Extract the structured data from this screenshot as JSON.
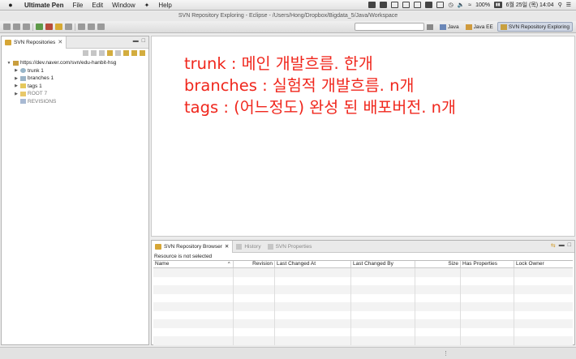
{
  "menubar": {
    "app_name": "Ultimate Pen",
    "items": [
      "File",
      "Edit",
      "Window",
      "Help"
    ],
    "battery": "100%",
    "datetime": "6월 25일 (목)  14:04"
  },
  "window": {
    "title": "SVN Repository Exploring - Eclipse - /Users/Hong/Dropbox/Bigdata_5/Java/Workspace"
  },
  "perspectives": [
    {
      "label": "Java",
      "active": false
    },
    {
      "label": "Java EE",
      "active": false
    },
    {
      "label": "SVN Repository Exploring",
      "active": true
    }
  ],
  "svn_repositories": {
    "tab_label": "SVN Repositories",
    "tree": {
      "root": "https://dev.naver.com/svn/edu-hanbit-hsg",
      "children": [
        "trunk 1",
        "branches 1",
        "tags 1",
        "ROOT 7",
        "REVISIONS"
      ]
    }
  },
  "annotation": {
    "lines": [
      "trunk : 메인 개발흐름. 한개",
      "branches : 실험적 개발흐름. n개",
      "tags : (어느정도) 완성 된 배포버전. n개"
    ],
    "color": "#f0271d"
  },
  "bottom_panel": {
    "tabs": [
      {
        "label": "SVN Repository Browser",
        "active": true
      },
      {
        "label": "History",
        "active": false
      },
      {
        "label": "SVN Properties",
        "active": false
      }
    ],
    "status": "Resource is not selected",
    "columns": [
      "Name",
      "Revision",
      "Last Changed At",
      "Last Changed By",
      "Size",
      "Has Properties",
      "Lock Owner"
    ]
  }
}
